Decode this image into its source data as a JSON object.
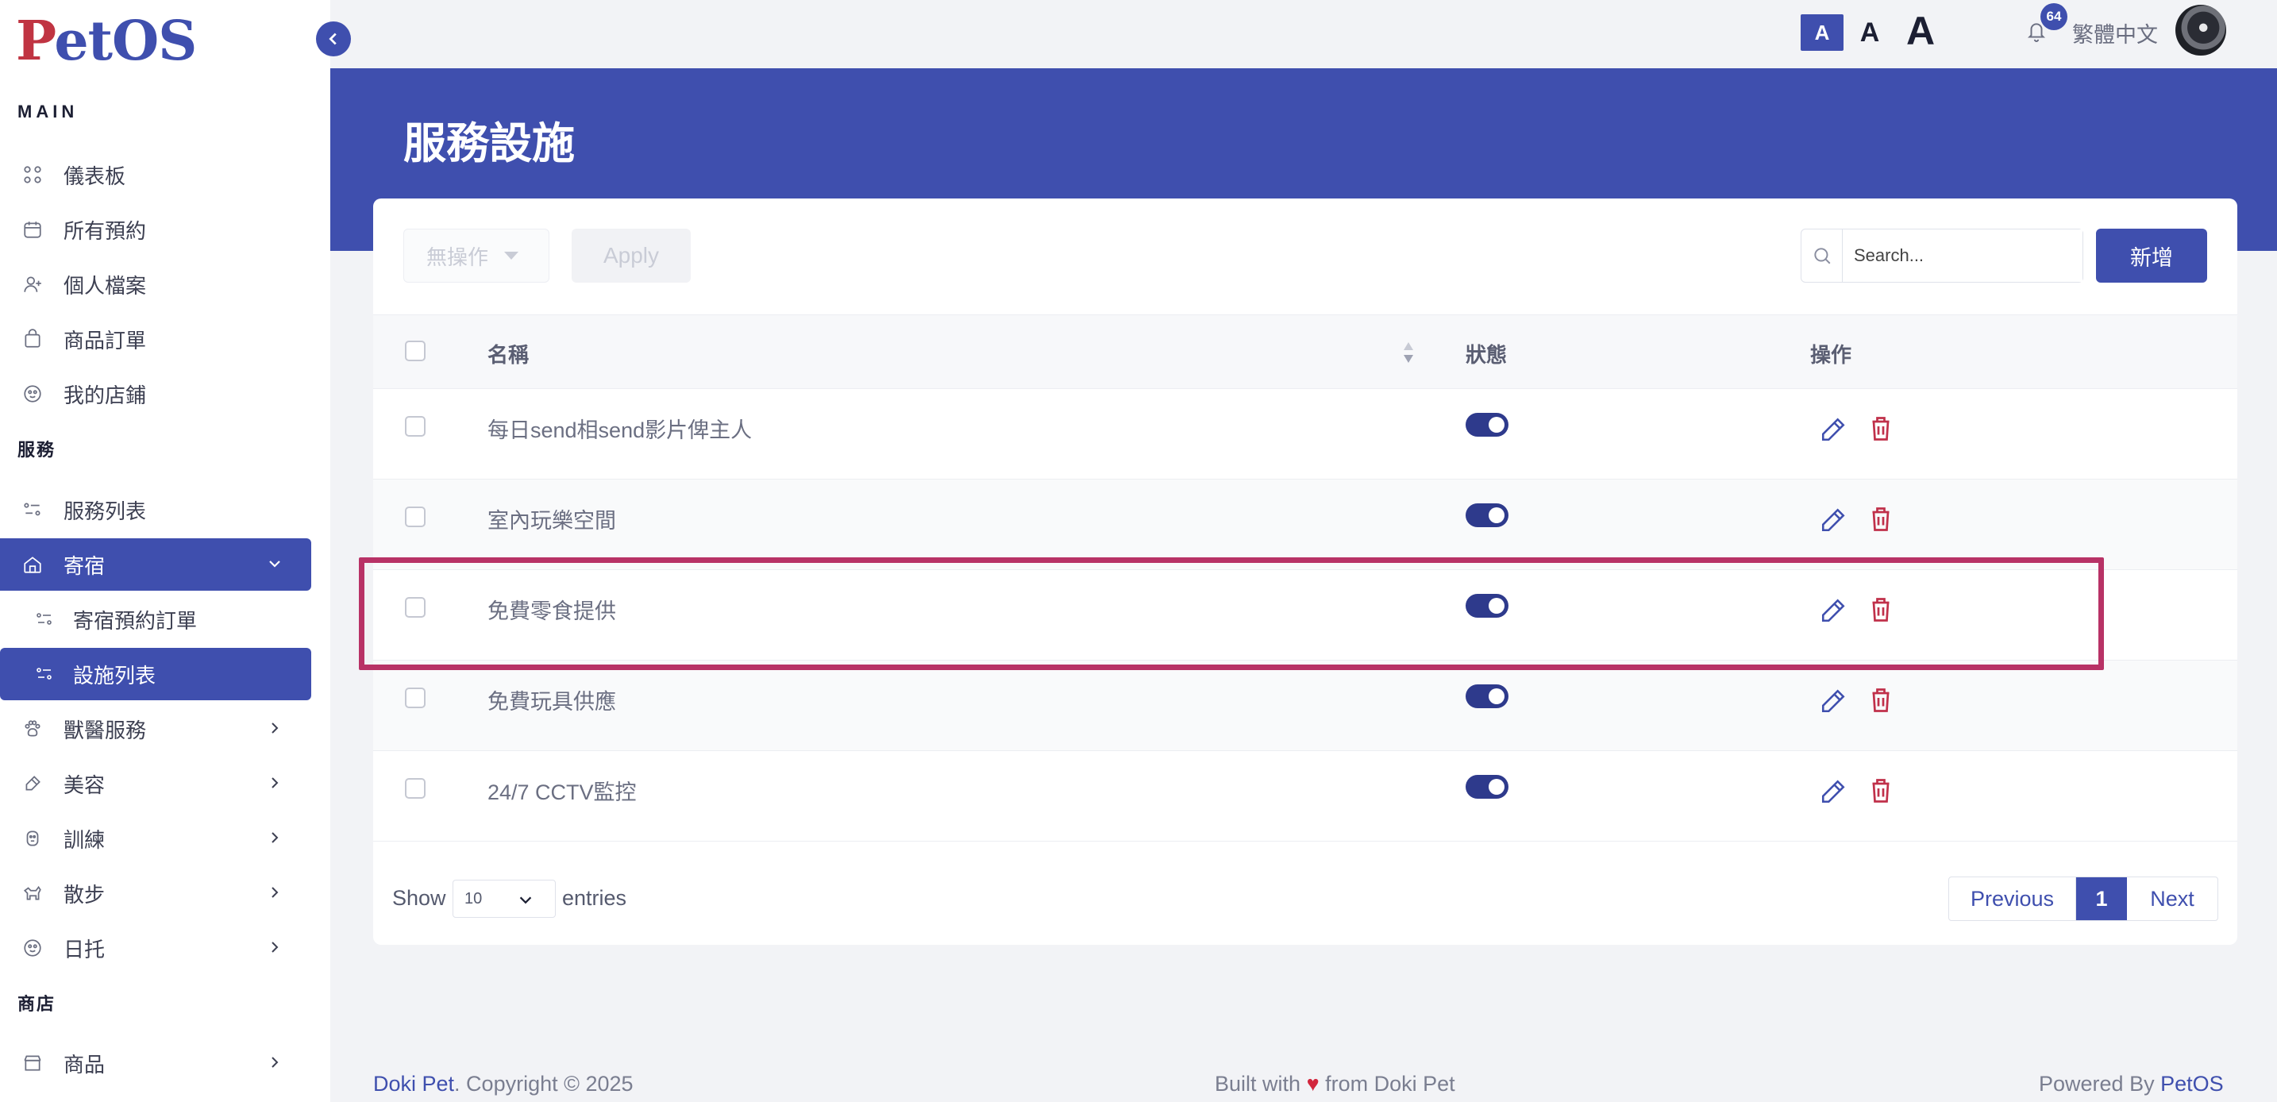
{
  "logo": {
    "p": "P",
    "rest": "etOS"
  },
  "sidebar": {
    "main_label": "MAIN",
    "main_items": [
      {
        "label": "儀表板",
        "icon": "dashboard-icon"
      },
      {
        "label": "所有預約",
        "icon": "calendar-icon"
      },
      {
        "label": "個人檔案",
        "icon": "user-icon"
      },
      {
        "label": "商品訂單",
        "icon": "bag-icon"
      },
      {
        "label": "我的店鋪",
        "icon": "paw-icon"
      }
    ],
    "service_label": "服務",
    "service_items": [
      {
        "label": "服務列表",
        "icon": "list-icon"
      },
      {
        "label": "寄宿",
        "icon": "home-icon",
        "active": true,
        "expanded": true
      },
      {
        "label": "寄宿預約訂單",
        "icon": "list-icon",
        "sub": true
      },
      {
        "label": "設施列表",
        "icon": "list-icon",
        "sub": true,
        "active": true
      },
      {
        "label": "獸醫服務",
        "icon": "paw-icon"
      },
      {
        "label": "美容",
        "icon": "brush-icon"
      },
      {
        "label": "訓練",
        "icon": "dog-icon"
      },
      {
        "label": "散步",
        "icon": "walk-icon"
      },
      {
        "label": "日托",
        "icon": "paw-icon"
      }
    ],
    "shop_label": "商店",
    "shop_items": [
      {
        "label": "商品",
        "icon": "store-icon"
      }
    ]
  },
  "header": {
    "font_small": "A",
    "font_medium": "A",
    "font_large": "A",
    "notification_count": "64",
    "language": "繁體中文"
  },
  "page": {
    "title": "服務設施"
  },
  "toolbar": {
    "bulk_action": "無操作",
    "apply_label": "Apply",
    "search_placeholder": "Search...",
    "add_label": "新增"
  },
  "table": {
    "columns": {
      "name": "名稱",
      "status": "狀態",
      "actions": "操作"
    },
    "rows": [
      {
        "name": "每日send相send影片俾主人",
        "enabled": true
      },
      {
        "name": "室內玩樂空間",
        "enabled": true
      },
      {
        "name": "免費零食提供",
        "enabled": true
      },
      {
        "name": "免費玩具供應",
        "enabled": true
      },
      {
        "name": "24/7 CCTV監控",
        "enabled": true
      }
    ]
  },
  "pagination": {
    "show_label": "Show",
    "page_length": "10",
    "entries_label": "entries",
    "previous_label": "Previous",
    "current_page": "1",
    "next_label": "Next"
  },
  "footer": {
    "left_brand": "Doki Pet",
    "left_rest": ". Copyright © 2025",
    "center_pre": "Built with",
    "center_post": "from Doki Pet",
    "right_pre": "Powered By",
    "right_brand": "PetOS"
  },
  "colors": {
    "primary": "#3f4fae",
    "danger": "#c0304a",
    "highlight": "#b83266"
  }
}
